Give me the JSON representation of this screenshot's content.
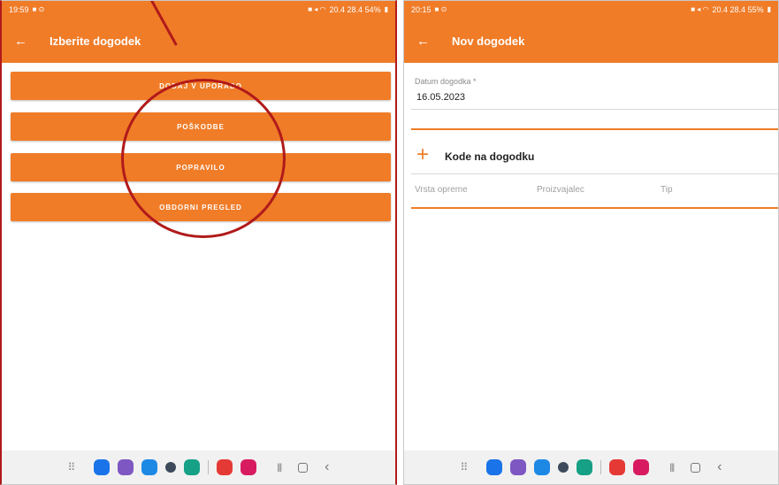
{
  "left": {
    "status": {
      "time": "19:59",
      "right": "20.4 28.4 54%"
    },
    "title": "Izberite dogodek",
    "buttons": [
      "DODAJ V UPORABO",
      "POŠKODBE",
      "POPRAVILO",
      "OBDORNI PREGLED"
    ]
  },
  "right": {
    "status": {
      "time": "20:15",
      "right": "20.4 28.4 55%"
    },
    "title": "Nov dogodek",
    "date_label": "Datum dogodka *",
    "date_value": "16.05.2023",
    "codes_title": "Kode na dogodku",
    "columns": [
      "Vrsta opreme",
      "Proizvajalec",
      "Tip"
    ]
  },
  "colors": {
    "accent": "#f07c28",
    "annotation": "#b11a1a",
    "nav_apps": [
      "#1a73e8",
      "#7e57c2",
      "#1e88e5",
      "#3c4a5c",
      "#16a085",
      "#e53935",
      "#d81b60"
    ]
  },
  "icons": {
    "back": "arrow-left-icon",
    "add": "plus-icon"
  }
}
